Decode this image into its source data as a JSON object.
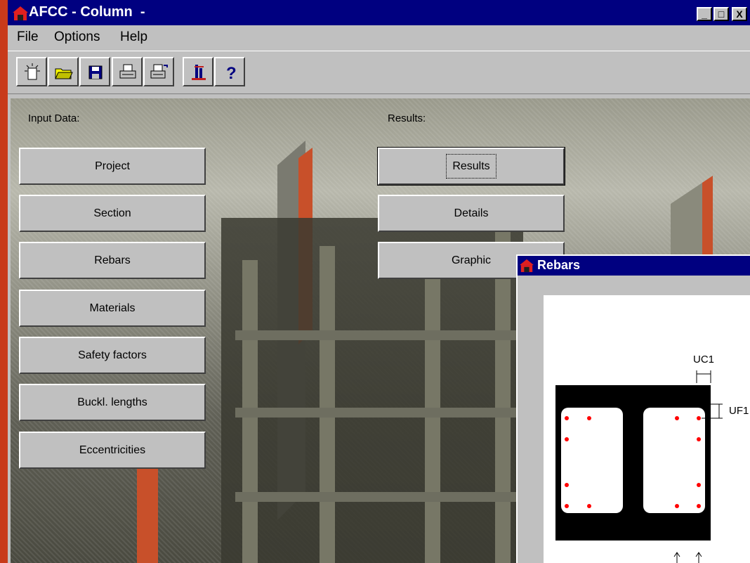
{
  "window": {
    "title": "AFCC - Column  -",
    "controls": [
      "_",
      "□",
      "X"
    ]
  },
  "menu": {
    "file": "File",
    "options": "Options",
    "help": "Help"
  },
  "toolbar": {
    "icons": [
      "new-file-icon",
      "open-folder-icon",
      "save-disk-icon",
      "print-icon",
      "printer-setup-icon",
      "calculate-icon",
      "help-icon"
    ]
  },
  "input_section": {
    "label": "Input Data:",
    "buttons": [
      "Project",
      "Section",
      "Rebars",
      "Materials",
      "Safety factors",
      "Buckl. lengths",
      "Eccentricities"
    ]
  },
  "results_section": {
    "label": "Results:",
    "buttons": [
      "Results",
      "Details",
      "Graphic"
    ]
  },
  "rebars_window": {
    "title": "Rebars",
    "labels": {
      "uc1": "UC1",
      "uf1": "UF1"
    }
  },
  "colors": {
    "title_bar": "#000080",
    "rebar_dot": "#ff0000",
    "face": "#c0c0c0"
  }
}
